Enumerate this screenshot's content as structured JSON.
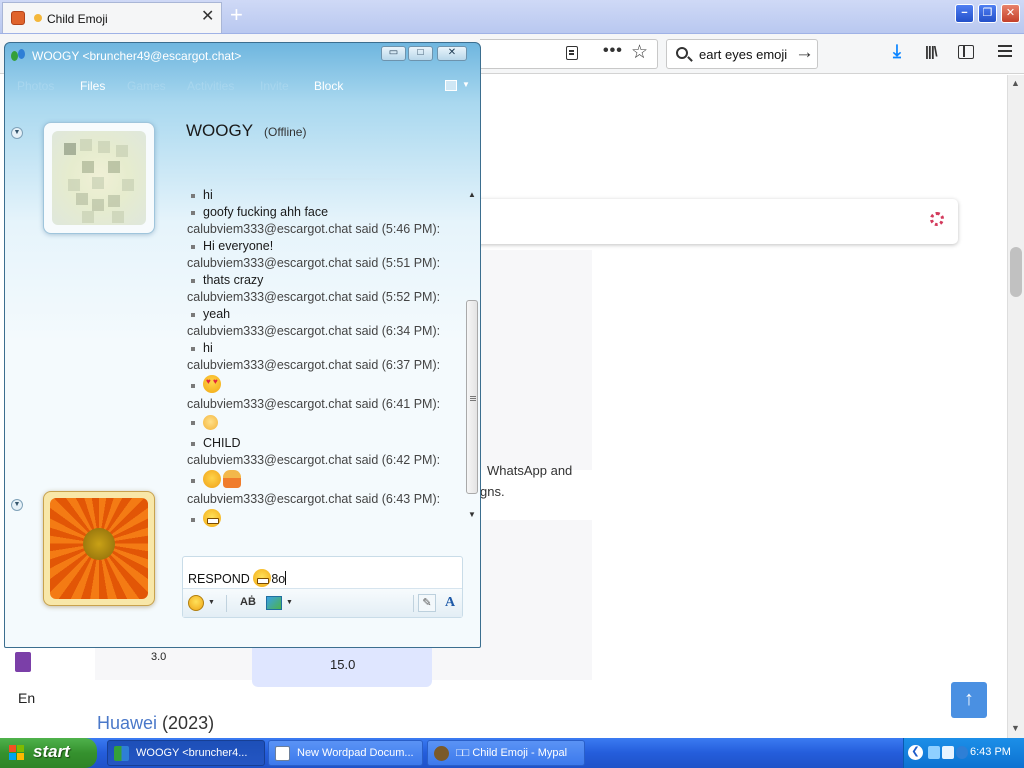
{
  "browser": {
    "tab_title": "Child Emoji",
    "tab_close": "✕",
    "new_tab": "+",
    "window_buttons": {
      "minimize": "−",
      "restore": "❐",
      "close": "✕"
    },
    "toolbar": {
      "search_value": "eart eyes emoji",
      "search_go": "→",
      "dots": "•••",
      "star": "☆",
      "download": "⤓",
      "library": "|||\\"
    },
    "page": {
      "text_line1": "WhatsApp and",
      "text_line2": "gns.",
      "value_15": "15.0",
      "value_3": "3.0",
      "heading_brand": "Huawei",
      "heading_year": "(2023)",
      "left_label": "En",
      "scroll_up": "↑"
    }
  },
  "chat": {
    "window_title": "WOOGY <bruncher49@escargot.chat>",
    "title_buttons": {
      "minimize": "▭",
      "maximize": "□",
      "close": "✕"
    },
    "toolbar": [
      {
        "label": "Photos",
        "enabled": false
      },
      {
        "label": "Files",
        "enabled": true
      },
      {
        "label": "Games",
        "enabled": false
      },
      {
        "label": "Activities",
        "enabled": false
      },
      {
        "label": "Invite",
        "enabled": false
      },
      {
        "label": "Block",
        "enabled": true
      }
    ],
    "contact_name": "WOOGY",
    "contact_status": "(Offline)",
    "messages": [
      {
        "kind": "body",
        "text": "hi"
      },
      {
        "kind": "body",
        "text": "goofy fucking ahh face"
      },
      {
        "kind": "meta",
        "text": "calubviem333@escargot.chat said (5:46 PM):"
      },
      {
        "kind": "body",
        "text": "Hi everyone!"
      },
      {
        "kind": "meta",
        "text": "calubviem333@escargot.chat said (5:51 PM):"
      },
      {
        "kind": "body",
        "text": "thats crazy"
      },
      {
        "kind": "meta",
        "text": "calubviem333@escargot.chat said (5:52 PM):"
      },
      {
        "kind": "body",
        "text": "yeah"
      },
      {
        "kind": "meta",
        "text": "calubviem333@escargot.chat said (6:34 PM):"
      },
      {
        "kind": "body",
        "text": "hi"
      },
      {
        "kind": "meta",
        "text": "calubviem333@escargot.chat said (6:37 PM):"
      },
      {
        "kind": "emoji",
        "icons": [
          "heart-eyes-emoji-icon"
        ]
      },
      {
        "kind": "meta",
        "text": "calubviem333@escargot.chat said (6:41 PM):"
      },
      {
        "kind": "emoji",
        "icons": [
          "child-emoji-icon"
        ]
      },
      {
        "kind": "body",
        "text": "CHILD"
      },
      {
        "kind": "meta",
        "text": "calubviem333@escargot.chat said (6:42 PM):"
      },
      {
        "kind": "emoji",
        "icons": [
          "shushing-face-emoji-icon",
          "person-emoji-icon"
        ]
      },
      {
        "kind": "meta",
        "text": "calubviem333@escargot.chat said (6:43 PM):"
      },
      {
        "kind": "emoji",
        "icons": [
          "grimacing-face-emoji-icon"
        ]
      }
    ],
    "input": {
      "text_before": "RESPOND",
      "text_after": "8o"
    },
    "input_toolbar": {
      "spell": "AḂ",
      "pen": "✎",
      "font": "A"
    }
  },
  "taskbar": {
    "start_label": "start",
    "tasks": [
      {
        "label": "WOOGY <bruncher4...",
        "active": true
      },
      {
        "label": "New Wordpad Docum...",
        "active": false
      },
      {
        "label": "□□ Child Emoji - Mypal",
        "active": false
      }
    ],
    "clock": "6:43 PM",
    "tray_arrow": "❮"
  },
  "colors": {
    "messenger_blue": "#6fb6df",
    "taskbar_blue": "#245ddb",
    "start_green": "#35912e"
  }
}
